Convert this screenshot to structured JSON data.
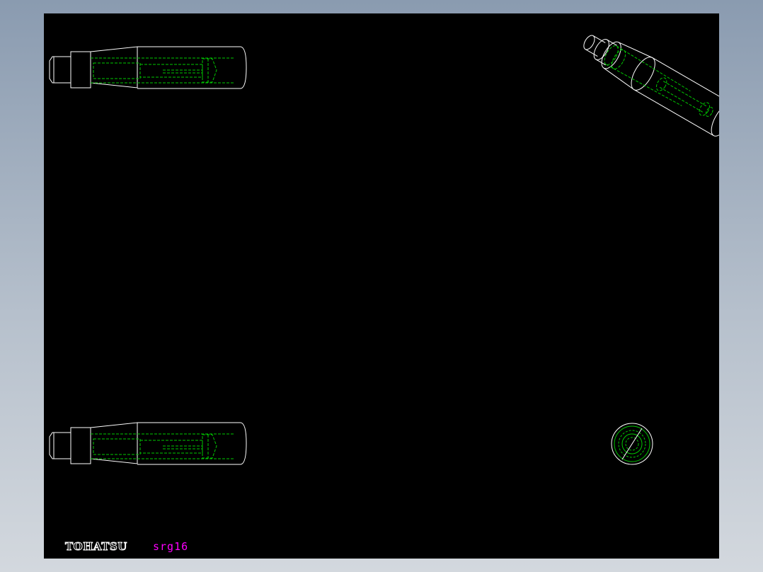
{
  "drawing": {
    "brand_label": "TOHATSU",
    "drawing_id": "srg16",
    "views": [
      {
        "name": "side-view-top",
        "type": "handle-side-view"
      },
      {
        "name": "isometric-view",
        "type": "handle-isometric-view"
      },
      {
        "name": "side-view-bottom",
        "type": "handle-side-view"
      },
      {
        "name": "end-view",
        "type": "handle-end-view"
      }
    ]
  },
  "colors": {
    "canvas": "#000000",
    "outline": "#ffffff",
    "hidden_lines": "#00c800",
    "drawing_id": "#ff00ff",
    "frame_gradient_top": "#8a9bb0",
    "frame_gradient_bottom": "#d3d8de"
  }
}
